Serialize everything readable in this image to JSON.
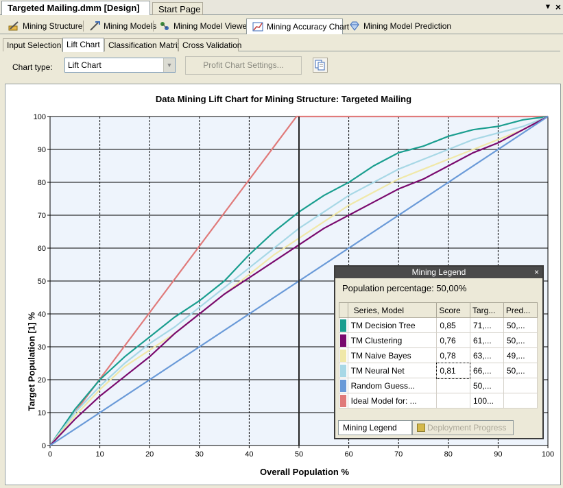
{
  "doc_tabs": {
    "active": "Targeted Mailing.dmm [Design]",
    "inactive": "Start Page",
    "dropdown_icon": "chevron-down-icon",
    "close_icon": "close-icon"
  },
  "designer_tabs": [
    {
      "label": "Mining Structure",
      "icon": "mining-structure-icon"
    },
    {
      "label": "Mining Models",
      "icon": "mining-models-icon"
    },
    {
      "label": "Mining Model Viewer",
      "icon": "model-viewer-icon"
    },
    {
      "label": "Mining Accuracy Chart",
      "icon": "accuracy-chart-icon"
    },
    {
      "label": "Mining Model Prediction",
      "icon": "diamond-icon"
    }
  ],
  "sub_tabs": [
    "Input Selection",
    "Lift Chart",
    "Classification Matrix",
    "Cross Validation"
  ],
  "toolbar": {
    "chart_type_label": "Chart type:",
    "chart_type_value": "Lift Chart",
    "profit_button": "Profit Chart Settings...",
    "copy_icon": "copy-icon"
  },
  "chart_data": {
    "type": "line",
    "title": "Data Mining Lift Chart for Mining Structure: Targeted Mailing",
    "xlabel": "Overall Population %",
    "ylabel": "Target Population [1] %",
    "xlim": [
      0,
      100
    ],
    "ylim": [
      0,
      100
    ],
    "xticks": [
      0,
      10,
      20,
      30,
      40,
      50,
      60,
      70,
      80,
      90,
      100
    ],
    "yticks": [
      0,
      10,
      20,
      30,
      40,
      50,
      60,
      70,
      80,
      90,
      100
    ],
    "grid": true,
    "cursor_x": 50,
    "series": [
      {
        "name": "Ideal Model for:",
        "color": "#e07a7a",
        "x": [
          0,
          49.5,
          100
        ],
        "y": [
          0,
          100,
          100
        ]
      },
      {
        "name": "TM Decision Tree",
        "color": "#1a9e8f",
        "x": [
          0,
          5,
          10,
          15,
          20,
          25,
          30,
          35,
          40,
          45,
          50,
          55,
          60,
          65,
          70,
          75,
          80,
          85,
          90,
          95,
          100
        ],
        "y": [
          0,
          11,
          20,
          27,
          33,
          39,
          44,
          50,
          58,
          65,
          71,
          76,
          80,
          85,
          89,
          91,
          94,
          96,
          97,
          99,
          100
        ]
      },
      {
        "name": "TM Neural Net",
        "color": "#a8d8e6",
        "x": [
          0,
          5,
          10,
          15,
          20,
          25,
          30,
          35,
          40,
          45,
          50,
          55,
          60,
          65,
          70,
          75,
          80,
          85,
          90,
          95,
          100
        ],
        "y": [
          0,
          10,
          18,
          25,
          31,
          36,
          42,
          48,
          54,
          60,
          66,
          71,
          76,
          80,
          84,
          87,
          90,
          93,
          95,
          97,
          100
        ]
      },
      {
        "name": "TM Naive Bayes",
        "color": "#f0e8a8",
        "x": [
          0,
          5,
          10,
          15,
          20,
          25,
          30,
          35,
          40,
          45,
          50,
          55,
          60,
          65,
          70,
          75,
          80,
          85,
          90,
          95,
          100
        ],
        "y": [
          0,
          9,
          17,
          24,
          29,
          34,
          40,
          46,
          52,
          58,
          63,
          68,
          73,
          77,
          81,
          84,
          87,
          90,
          93,
          96,
          100
        ]
      },
      {
        "name": "TM Clustering",
        "color": "#7a0a6e",
        "x": [
          0,
          5,
          10,
          15,
          20,
          25,
          30,
          35,
          40,
          45,
          50,
          55,
          60,
          65,
          70,
          75,
          80,
          85,
          90,
          95,
          100
        ],
        "y": [
          0,
          8,
          15,
          21,
          27,
          34,
          40,
          46,
          51,
          56,
          61,
          66,
          70,
          74,
          78,
          81,
          85,
          89,
          92,
          96,
          100
        ]
      },
      {
        "name": "Random Guess...",
        "color": "#6a9ad8",
        "x": [
          0,
          100
        ],
        "y": [
          0,
          100
        ]
      }
    ]
  },
  "legend": {
    "title": "Mining Legend",
    "close_icon": "close-icon",
    "population": "Population percentage: 50,00%",
    "columns": [
      "Series, Model",
      "Score",
      "Targ...",
      "Pred..."
    ],
    "rows": [
      {
        "color": "#1a9e8f",
        "name": "TM Decision Tree",
        "score": "0,85",
        "target": "71,...",
        "pred": "50,..."
      },
      {
        "color": "#7a0a6e",
        "name": "TM Clustering",
        "score": "0,76",
        "target": "61,...",
        "pred": "50,..."
      },
      {
        "color": "#f0e8a8",
        "name": "TM Naive Bayes",
        "score": "0,78",
        "target": "63,...",
        "pred": "49,..."
      },
      {
        "color": "#a8d8e6",
        "name": "TM Neural Net",
        "score": "0,81",
        "target": "66,...",
        "pred": "50,..."
      },
      {
        "color": "#6a9ad8",
        "name": "Random Guess...",
        "score": "",
        "target": "50,...",
        "pred": ""
      },
      {
        "color": "#e07a7a",
        "name": "Ideal Model for: ...",
        "score": "",
        "target": "100...",
        "pred": ""
      }
    ],
    "tabs": [
      "Mining Legend",
      "Deployment Progress"
    ]
  }
}
